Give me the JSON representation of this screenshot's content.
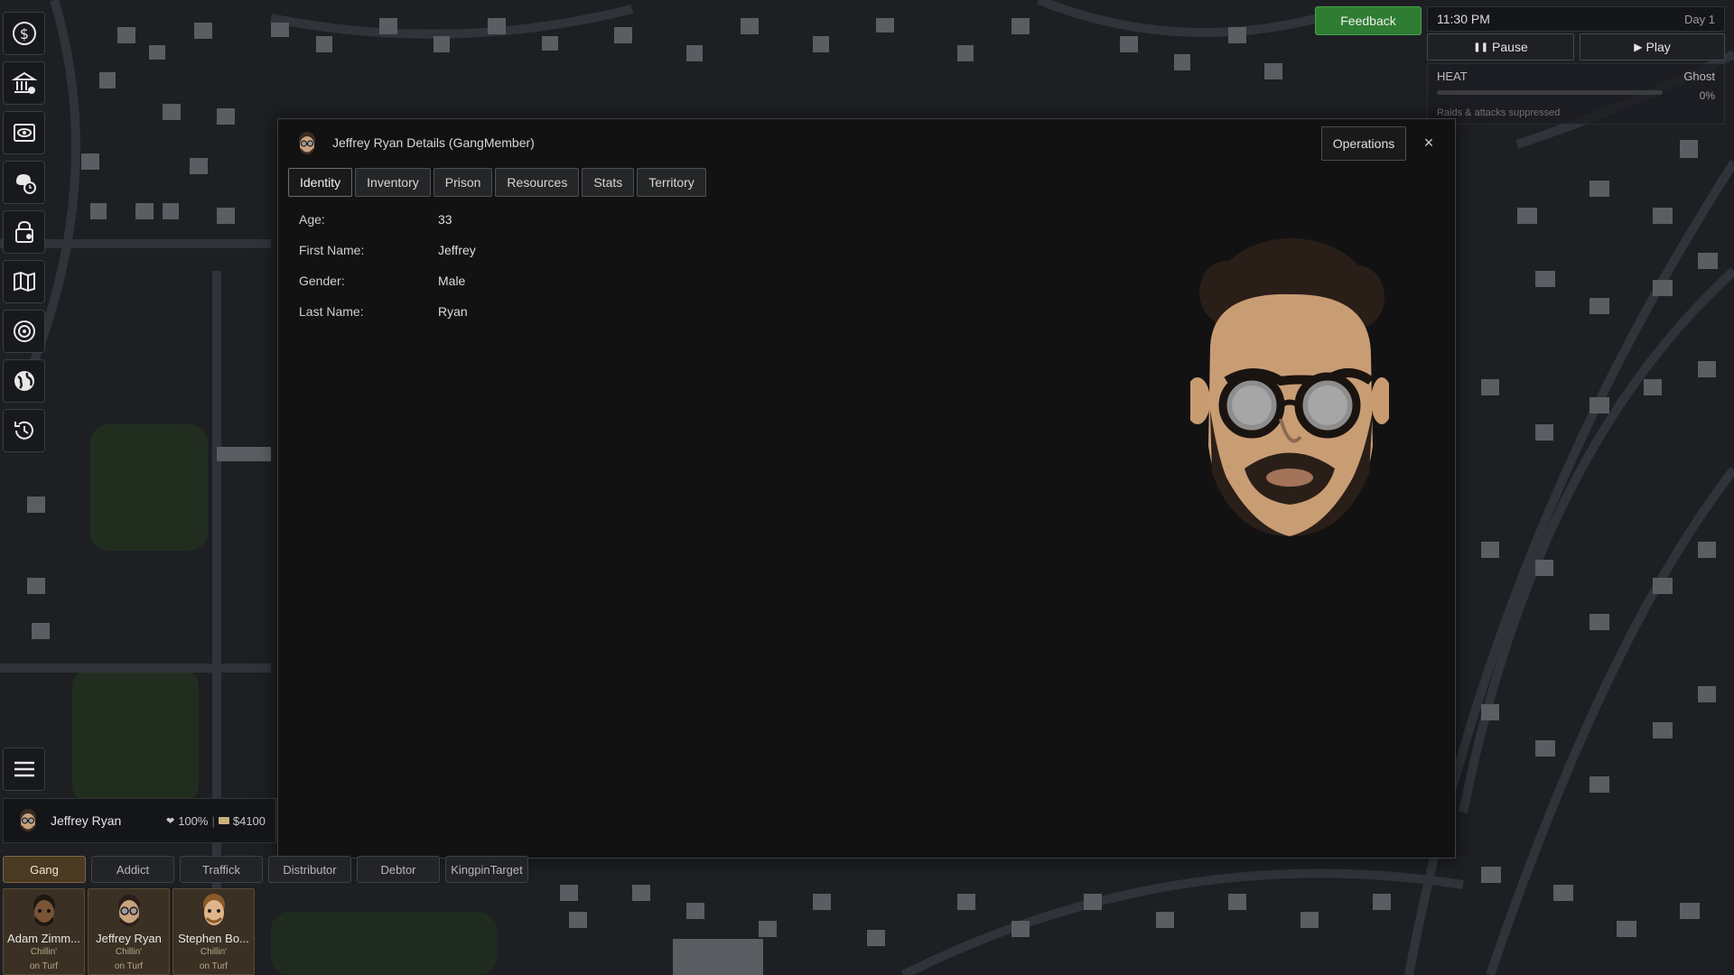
{
  "hud": {
    "feedback_label": "Feedback",
    "time": "11:30 PM",
    "day": "Day 1",
    "pause_label": "Pause",
    "play_label": "Play",
    "heat_label": "HEAT",
    "heat_level": "Ghost",
    "heat_percent": "0%",
    "heat_note": "Raids & attacks suppressed"
  },
  "toolbar": {
    "icons": [
      "dollar-icon",
      "bank-icon",
      "eye-icon",
      "brain-clock-icon",
      "lock-user-icon",
      "map-icon",
      "target-icon",
      "globe-icon",
      "history-icon",
      "menu-icon"
    ]
  },
  "dialog": {
    "title": "Jeffrey Ryan Details (GangMember)",
    "operations_label": "Operations",
    "close_label": "×",
    "tabs": [
      {
        "label": "Identity",
        "active": true
      },
      {
        "label": "Inventory",
        "active": false
      },
      {
        "label": "Prison",
        "active": false
      },
      {
        "label": "Resources",
        "active": false
      },
      {
        "label": "Stats",
        "active": false
      },
      {
        "label": "Territory",
        "active": false
      }
    ],
    "fields": [
      {
        "label": "Age:",
        "value": "33"
      },
      {
        "label": "First Name:",
        "value": "Jeffrey"
      },
      {
        "label": "Gender:",
        "value": "Male"
      },
      {
        "label": "Last Name:",
        "value": "Ryan"
      }
    ]
  },
  "selected_member": {
    "name": "Jeffrey Ryan",
    "health": "100%",
    "separator": "|",
    "cash": "$4100"
  },
  "filters": [
    {
      "label": "Gang",
      "active": true
    },
    {
      "label": "Addict",
      "active": false
    },
    {
      "label": "Traffick",
      "active": false
    },
    {
      "label": "Distributor",
      "active": false
    },
    {
      "label": "Debtor",
      "active": false
    },
    {
      "label": "KingpinTarget",
      "active": false
    }
  ],
  "roster": [
    {
      "name": "Adam Zimm...",
      "status1": "Chillin'",
      "status2": "on Turf"
    },
    {
      "name": "Jeffrey Ryan",
      "status1": "Chillin'",
      "status2": "on Turf"
    },
    {
      "name": "Stephen Bo...",
      "status1": "Chillin'",
      "status2": "on Turf"
    }
  ],
  "colors": {
    "feedback": "#2f7d32",
    "active_filter": "#4a3a22",
    "card_bg": "#3b3024",
    "dialog_bg": "#121212"
  }
}
